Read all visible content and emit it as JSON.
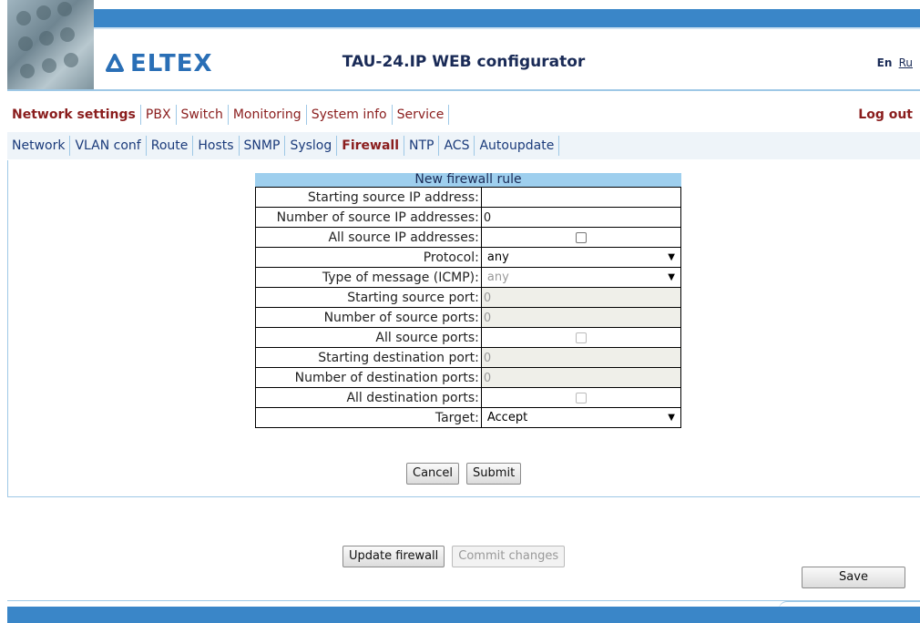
{
  "header": {
    "logo_text": "ELTEX",
    "title": "TAU-24.IP WEB configurator",
    "lang_en": "En",
    "lang_ru": "Ru",
    "brand_color": "#2a6fb6"
  },
  "menu": {
    "items": [
      "Network settings",
      "PBX",
      "Switch",
      "Monitoring",
      "System info",
      "Service"
    ],
    "active": "Network settings",
    "logout": "Log out"
  },
  "submenu": {
    "items": [
      "Network",
      "VLAN conf",
      "Route",
      "Hosts",
      "SNMP",
      "Syslog",
      "Firewall",
      "NTP",
      "ACS",
      "Autoupdate"
    ],
    "active": "Firewall"
  },
  "form": {
    "caption": "New firewall rule",
    "rows": [
      {
        "label": "Starting source IP address:",
        "value": "",
        "kind": "text",
        "disabled": false
      },
      {
        "label": "Number of source IP addresses:",
        "value": "0",
        "kind": "text",
        "disabled": false
      },
      {
        "label": "All source IP addresses:",
        "value": false,
        "kind": "checkbox",
        "disabled": false
      },
      {
        "label": "Protocol:",
        "value": "any",
        "kind": "select",
        "disabled": false
      },
      {
        "label": "Type of message (ICMP):",
        "value": "any",
        "kind": "select",
        "disabled": true
      },
      {
        "label": "Starting source port:",
        "value": "0",
        "kind": "text",
        "disabled": true
      },
      {
        "label": "Number of source ports:",
        "value": "0",
        "kind": "text",
        "disabled": true
      },
      {
        "label": "All source ports:",
        "value": false,
        "kind": "checkbox",
        "disabled": true
      },
      {
        "label": "Starting destination port:",
        "value": "0",
        "kind": "text",
        "disabled": true
      },
      {
        "label": "Number of destination ports:",
        "value": "0",
        "kind": "text",
        "disabled": true
      },
      {
        "label": "All destination ports:",
        "value": false,
        "kind": "checkbox",
        "disabled": true
      },
      {
        "label": "Target:",
        "value": "Accept",
        "kind": "select",
        "disabled": false
      }
    ],
    "cancel": "Cancel",
    "submit": "Submit"
  },
  "actions": {
    "update_firewall": "Update firewall",
    "commit_changes": "Commit changes",
    "save": "Save"
  }
}
